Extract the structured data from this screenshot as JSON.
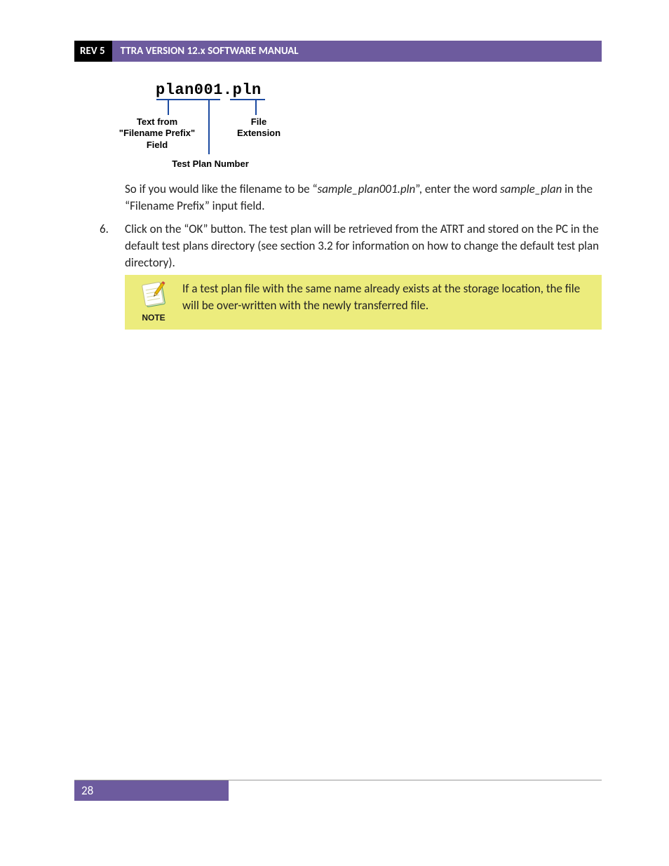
{
  "header": {
    "rev": "REV 5",
    "title": "TTRA VERSION 12.x SOFTWARE MANUAL"
  },
  "diagram": {
    "filename": "plan001.pln",
    "label_prefix": "Text from \"Filename Prefix\" Field",
    "label_ext": "File Extension",
    "label_num": "Test Plan Number"
  },
  "para1_a": "So if you would like the filename to be “",
  "para1_i": "sample_plan001.pln",
  "para1_b": "”, enter the word ",
  "para1_i2": "sample_plan",
  "para1_c": " in the “Filename Prefix” input field.",
  "list6_marker": "6.",
  "list6_text": "Click on the “OK” button. The test plan will be retrieved from the ATRT and stored on the PC in the default test plans directory (see section 3.2 for information on how to change the default test plan directory).",
  "note": {
    "label": "NOTE",
    "text": "If a test plan file with the same name already exists at the storage location, the file will be over-written with the newly transferred file."
  },
  "footer": {
    "page": "28"
  }
}
